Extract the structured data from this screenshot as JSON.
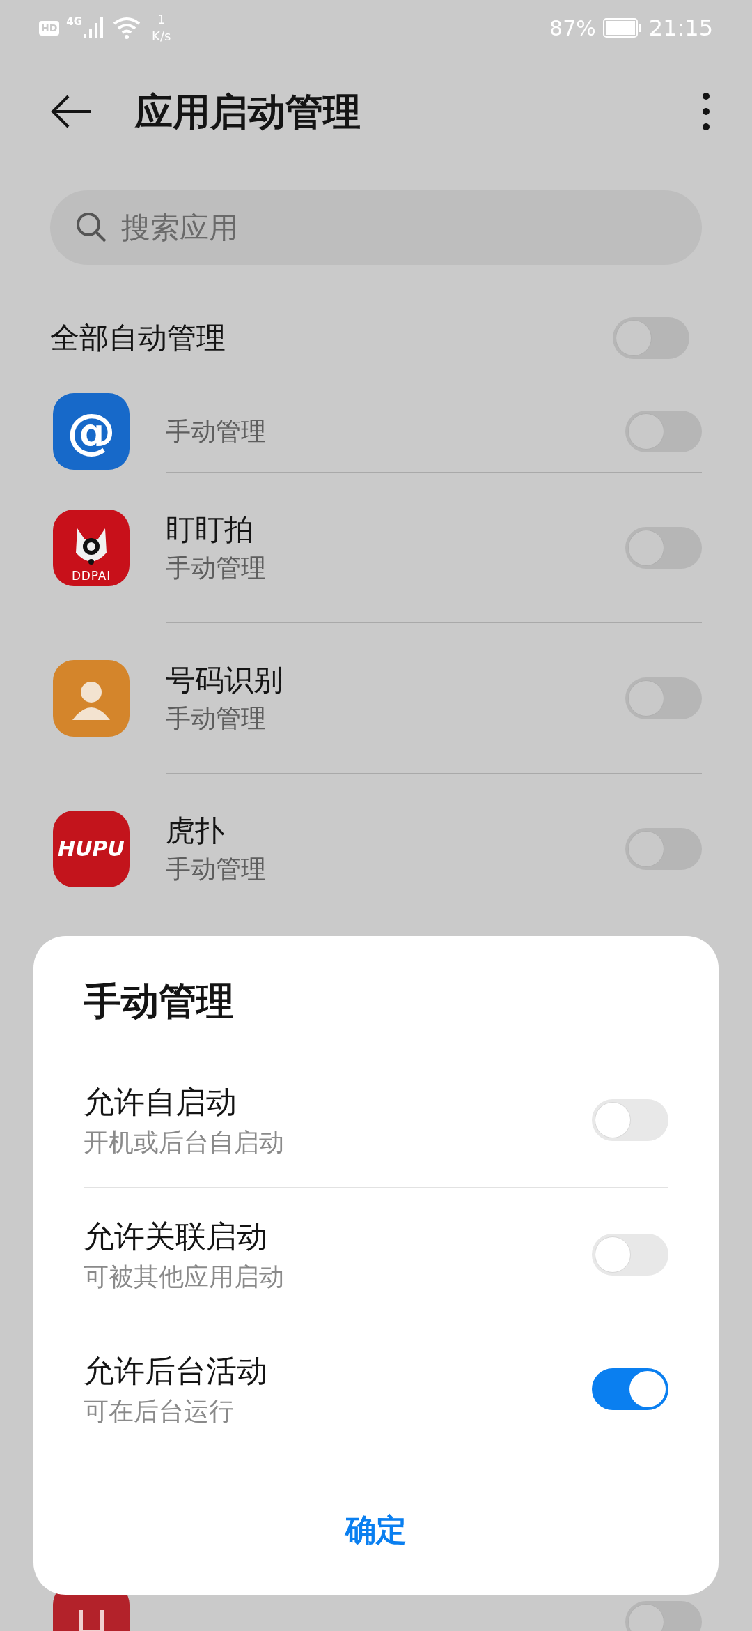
{
  "status_bar": {
    "hd": "HD",
    "network": "4G",
    "speed_value": "1",
    "speed_unit": "K/s",
    "battery": "87%",
    "time": "21:15"
  },
  "header": {
    "title": "应用启动管理"
  },
  "search": {
    "placeholder": "搜索应用"
  },
  "auto_all": {
    "label": "全部自动管理",
    "on": false
  },
  "apps": [
    {
      "kind": "mail",
      "icon_text": "@",
      "subtitle": "手动管理",
      "on": false
    },
    {
      "kind": "ddpai",
      "icon_text": "DDPAI",
      "name": "盯盯拍",
      "subtitle": "手动管理",
      "on": false
    },
    {
      "kind": "contact",
      "name": "号码识别",
      "subtitle": "手动管理",
      "on": false
    },
    {
      "kind": "hupu",
      "icon_text": "HUPU",
      "name": "虎扑",
      "subtitle": "手动管理",
      "on": false
    }
  ],
  "bottom_app": {
    "on": false
  },
  "dialog": {
    "title": "手动管理",
    "options": [
      {
        "label": "允许自启动",
        "description": "开机或后台自启动",
        "on": false
      },
      {
        "label": "允许关联启动",
        "description": "可被其他应用启动",
        "on": false
      },
      {
        "label": "允许后台活动",
        "description": "可在后台运行",
        "on": true
      }
    ],
    "confirm": "确定"
  }
}
